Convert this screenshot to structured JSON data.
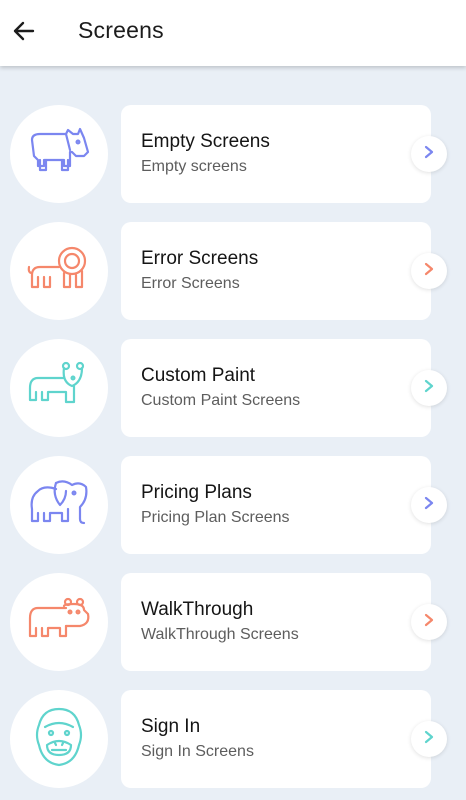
{
  "appbar": {
    "title": "Screens",
    "back_icon": "arrow-left-icon"
  },
  "items": [
    {
      "title": "Empty Screens",
      "subtitle": "Empty screens",
      "icon": "rhino-icon",
      "color": "#7b86f0"
    },
    {
      "title": "Error Screens",
      "subtitle": "Error Screens",
      "icon": "lion-icon",
      "color": "#f5876b"
    },
    {
      "title": "Custom Paint",
      "subtitle": "Custom Paint Screens",
      "icon": "bear-icon",
      "color": "#5fd4cd"
    },
    {
      "title": "Pricing Plans",
      "subtitle": "Pricing Plan Screens",
      "icon": "elephant-icon",
      "color": "#7b86f0"
    },
    {
      "title": "WalkThrough",
      "subtitle": "WalkThrough Screens",
      "icon": "hippo-icon",
      "color": "#f5876b"
    },
    {
      "title": "Sign In",
      "subtitle": "Sign In Screens",
      "icon": "gorilla-icon",
      "color": "#5fd4cd"
    }
  ]
}
